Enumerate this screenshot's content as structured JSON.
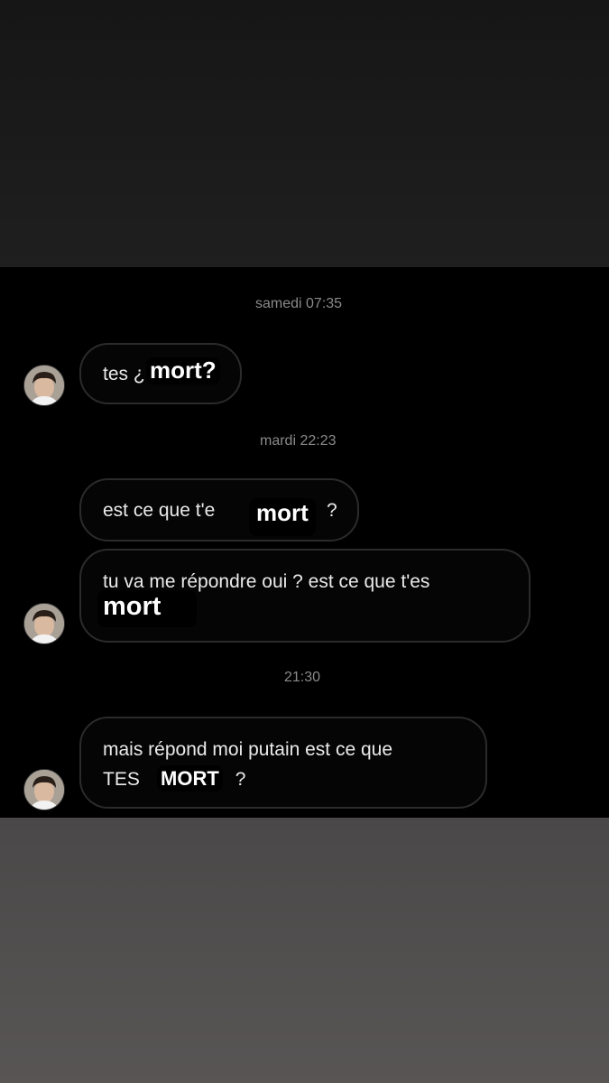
{
  "conversation": {
    "groups": [
      {
        "timestamp": "samedi 07:35",
        "messages": [
          {
            "text": "tes ¿",
            "overlay": "mort?"
          }
        ]
      },
      {
        "timestamp": "mardi 22:23",
        "messages": [
          {
            "text": "est ce que t'e",
            "overlay": "mort",
            "text_after": "?"
          },
          {
            "text": "tu va me répondre oui ? est ce que t'es",
            "overlay": "mort"
          }
        ]
      },
      {
        "timestamp": "21:30",
        "messages": [
          {
            "text_line1": "mais répond moi putain est ce que",
            "text_line2": "TES",
            "overlay": "MORT",
            "text_after": "?"
          }
        ]
      }
    ]
  },
  "colors": {
    "background": "#000000",
    "bubble_border": "#2b2b2b",
    "bubble_text": "#eaeaea",
    "timestamp": "#8a8a8a",
    "overlay_text": "#ffffff"
  },
  "icons": {
    "avatar": "user-avatar-photo"
  }
}
